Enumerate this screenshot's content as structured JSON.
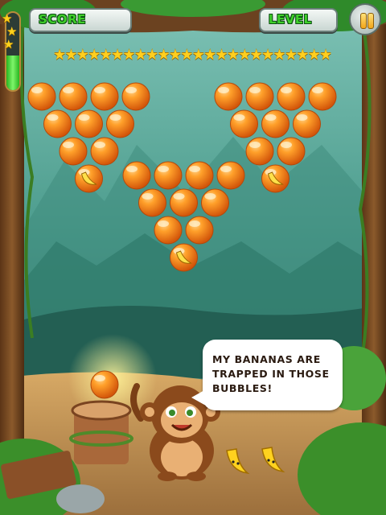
{
  "hud": {
    "score_label": "SCORE",
    "level_label": "LEVEL",
    "pause_icon": "pause-icon",
    "progress_fraction": 0.45,
    "progress_star_count": 3
  },
  "star_row": {
    "star_count": 24,
    "icon": "star-icon"
  },
  "bubbles": {
    "color": "#f07d10",
    "groups": {
      "left": {
        "rows": [
          4,
          3,
          2,
          1
        ],
        "banana_bubbles": 1
      },
      "center": {
        "rows": [
          4,
          3,
          2,
          1
        ],
        "banana_bubbles": 1
      },
      "right": {
        "rows": [
          4,
          3,
          2,
          1
        ],
        "banana_bubbles": 1
      }
    },
    "loaded_bubble_color": "#f07d10",
    "held_bubble_color": "#f07d10"
  },
  "speech": {
    "text": "MY BANANAS ARE TRAPPED IN THOSE BUBBLES!"
  },
  "characters": {
    "monkey": "monkey-character",
    "bananas": [
      "banana-character",
      "banana-character"
    ]
  },
  "colors": {
    "sky_top": "#7fc3b6",
    "sky_bottom": "#2e7f73",
    "ground": "#c89a5c",
    "bubble": "#f07d10",
    "hud_text": "#3fcf2a",
    "star": "#ffcf1f"
  }
}
